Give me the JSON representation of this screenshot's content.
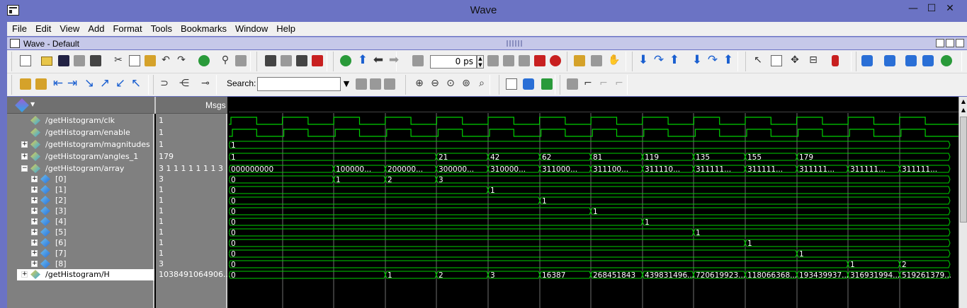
{
  "window": {
    "title": "Wave",
    "controls": [
      "—",
      "☐",
      "✕"
    ]
  },
  "menu": [
    "File",
    "Edit",
    "View",
    "Add",
    "Format",
    "Tools",
    "Bookmarks",
    "Window",
    "Help"
  ],
  "subwindow": {
    "title": "Wave - Default"
  },
  "toolbar": {
    "time_value": "0 ps",
    "search_label": "Search:",
    "search_value": ""
  },
  "panel": {
    "msgs_header": "Msgs"
  },
  "signals": [
    {
      "name": "/getHistogram/clk",
      "value": "1",
      "expander": "",
      "kind": "bit",
      "indent": 0
    },
    {
      "name": "/getHistogram/enable",
      "value": "1",
      "expander": "",
      "kind": "bit",
      "indent": 0
    },
    {
      "name": "/getHistogram/magnitudes",
      "value": "1",
      "expander": "+",
      "kind": "bus",
      "indent": 0
    },
    {
      "name": "/getHistogram/angles_1",
      "value": "179",
      "expander": "+",
      "kind": "bus",
      "indent": 0
    },
    {
      "name": "/getHistogram/array",
      "value": "3 1 1 1 1 1 1 1 3",
      "expander": "−",
      "kind": "bus",
      "indent": 0
    },
    {
      "name": "[0]",
      "value": "3",
      "expander": "+",
      "kind": "bus",
      "indent": 1
    },
    {
      "name": "[1]",
      "value": "1",
      "expander": "+",
      "kind": "bus",
      "indent": 1
    },
    {
      "name": "[2]",
      "value": "1",
      "expander": "+",
      "kind": "bus",
      "indent": 1
    },
    {
      "name": "[3]",
      "value": "1",
      "expander": "+",
      "kind": "bus",
      "indent": 1
    },
    {
      "name": "[4]",
      "value": "1",
      "expander": "+",
      "kind": "bus",
      "indent": 1
    },
    {
      "name": "[5]",
      "value": "1",
      "expander": "+",
      "kind": "bus",
      "indent": 1
    },
    {
      "name": "[6]",
      "value": "1",
      "expander": "+",
      "kind": "bus",
      "indent": 1
    },
    {
      "name": "[7]",
      "value": "1",
      "expander": "+",
      "kind": "bus",
      "indent": 1
    },
    {
      "name": "[8]",
      "value": "3",
      "expander": "+",
      "kind": "bus",
      "indent": 1
    },
    {
      "name": "/getHistogram/H",
      "value": "1038491064906...",
      "expander": "+",
      "kind": "bus",
      "indent": 0,
      "selected": true
    }
  ],
  "waveforms": {
    "clk_period_cols": 2,
    "bus_values": [
      [
        [
          "1",
          0
        ]
      ],
      [
        [
          "1",
          0
        ],
        [
          "21",
          4
        ],
        [
          "42",
          5
        ],
        [
          "62",
          6
        ],
        [
          "81",
          7
        ],
        [
          "119",
          8
        ],
        [
          "135",
          9
        ],
        [
          "155",
          10
        ],
        [
          "179",
          11
        ]
      ],
      [
        [
          "000000000",
          0
        ],
        [
          "100000...",
          2
        ],
        [
          "200000...",
          3
        ],
        [
          "300000...",
          4
        ],
        [
          "310000...",
          5
        ],
        [
          "311000...",
          6
        ],
        [
          "311100...",
          7
        ],
        [
          "311110...",
          8
        ],
        [
          "311111...",
          9
        ],
        [
          "311111...",
          10
        ],
        [
          "311111...",
          11
        ],
        [
          "311111...",
          12
        ],
        [
          "311111...",
          13
        ]
      ],
      [
        [
          "0",
          0
        ],
        [
          "1",
          2
        ],
        [
          "2",
          3
        ],
        [
          "3",
          4
        ]
      ],
      [
        [
          "0",
          0
        ],
        [
          "1",
          5
        ]
      ],
      [
        [
          "0",
          0
        ],
        [
          "1",
          6
        ]
      ],
      [
        [
          "0",
          0
        ],
        [
          "1",
          7
        ]
      ],
      [
        [
          "0",
          0
        ],
        [
          "1",
          8
        ]
      ],
      [
        [
          "0",
          0
        ],
        [
          "1",
          9
        ]
      ],
      [
        [
          "0",
          0
        ],
        [
          "1",
          10
        ]
      ],
      [
        [
          "0",
          0
        ],
        [
          "1",
          11
        ]
      ],
      [
        [
          "0",
          0
        ],
        [
          "1",
          12
        ],
        [
          "2",
          13
        ]
      ],
      [
        [
          "0",
          0
        ],
        [
          "1",
          3
        ],
        [
          "2",
          4
        ],
        [
          "3",
          5
        ],
        [
          "16387",
          6
        ],
        [
          "268451843",
          7
        ],
        [
          "439831496...",
          8
        ],
        [
          "720619923...",
          9
        ],
        [
          "118066368...",
          10
        ],
        [
          "193439937...",
          11
        ],
        [
          "316931994...",
          12
        ],
        [
          "519261379...",
          13
        ]
      ]
    ]
  },
  "colors": {
    "wave": "#00d000",
    "grid": "#6e6e6e",
    "panel": "#808080"
  }
}
